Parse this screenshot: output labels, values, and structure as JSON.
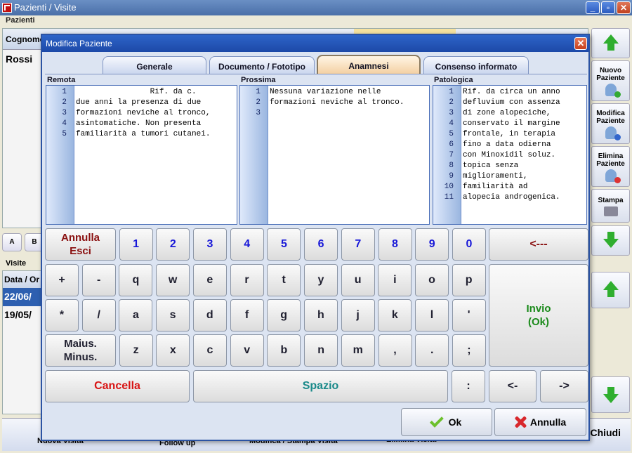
{
  "window": {
    "title": "Pazienti / Visite",
    "controls": [
      "_",
      "▫",
      "✕"
    ]
  },
  "patients": {
    "label": "Pazienti",
    "column": "Cognome",
    "rows": [
      "Rossi"
    ],
    "alpha": [
      "A",
      "B"
    ]
  },
  "visits": {
    "label": "Visite",
    "column": "Data / Or",
    "rows": [
      "22/06/",
      "19/05/"
    ]
  },
  "bottom": {
    "buttons": [
      "Nuova Visita",
      "Follow up",
      "Modifica / Stampa Visita",
      "Elimina Visita"
    ],
    "close": "Chiudi"
  },
  "side": {
    "nuovo": "Nuovo Paziente",
    "modifica": "Modifica Paziente",
    "elimina": "Elimina Paziente",
    "stampa": "Stampa"
  },
  "modal": {
    "title": "Modifica Paziente",
    "tabs": [
      "Generale",
      "Documento / Fototipo",
      "Anamnesi",
      "Consenso informato"
    ],
    "active_tab": "Anamnesi",
    "sections": [
      {
        "label": "Remota",
        "lines": [
          "                Rif. da c.",
          "due anni la presenza di due",
          "formazioni neviche al tronco,",
          "asintomatiche. Non presenta",
          "familiarità a tumori cutanei."
        ]
      },
      {
        "label": "Prossima",
        "lines": [
          "Nessuna variazione nelle",
          "formazioni neviche al tronco.",
          ""
        ]
      },
      {
        "label": "Patologica",
        "lines": [
          "Rif. da circa un anno",
          "defluvium con assenza",
          "di zone alopeciche,",
          "conservato il margine",
          "frontale, in terapia",
          "fino a data odierna",
          "con Minoxidil soluz.",
          "topica senza",
          "miglioramenti,",
          "familiarità ad",
          "alopecia androgenica."
        ]
      }
    ],
    "keyboard": {
      "row1": [
        "1",
        "2",
        "3",
        "4",
        "5",
        "6",
        "7",
        "8",
        "9",
        "0"
      ],
      "row2": [
        "+",
        "-",
        "q",
        "w",
        "e",
        "r",
        "t",
        "y",
        "u",
        "i",
        "o",
        "p"
      ],
      "row3": [
        "*",
        "/",
        "a",
        "s",
        "d",
        "f",
        "g",
        "h",
        "j",
        "k",
        "l",
        "'"
      ],
      "row4": [
        "z",
        "x",
        "c",
        "v",
        "b",
        "n",
        "m",
        ",",
        ".",
        ";"
      ],
      "annulla": "Annulla\nEsci",
      "backspace": "<---",
      "invio": "Invio\n(Ok)",
      "maius": "Maius.\nMinus.",
      "cancella": "Cancella",
      "spazio": "Spazio",
      "colon": ":",
      "left": "<-",
      "right": "->"
    },
    "ok": "Ok",
    "annulla": "Annulla"
  }
}
